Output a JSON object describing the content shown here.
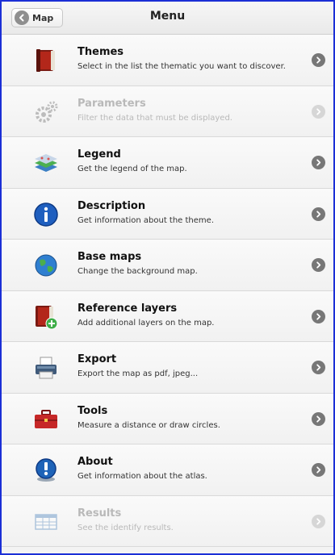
{
  "header": {
    "back_label": "Map",
    "title": "Menu"
  },
  "menu": [
    {
      "label": "Themes",
      "description": "Select in the list the thematic you want to discover.",
      "icon": "book-icon",
      "enabled": true
    },
    {
      "label": "Parameters",
      "description": "Filter the data that must be displayed.",
      "icon": "gears-icon",
      "enabled": false
    },
    {
      "label": "Legend",
      "description": "Get the legend of the map.",
      "icon": "layers-icon",
      "enabled": true
    },
    {
      "label": "Description",
      "description": "Get information about the theme.",
      "icon": "info-icon",
      "enabled": true
    },
    {
      "label": "Base maps",
      "description": "Change the background map.",
      "icon": "globe-icon",
      "enabled": true
    },
    {
      "label": "Reference layers",
      "description": "Add additional layers on the map.",
      "icon": "book-add-icon",
      "enabled": true
    },
    {
      "label": "Export",
      "description": "Export the map as pdf, jpeg...",
      "icon": "printer-icon",
      "enabled": true
    },
    {
      "label": "Tools",
      "description": "Measure a distance or draw circles.",
      "icon": "toolbox-icon",
      "enabled": true
    },
    {
      "label": "About",
      "description": "Get information about the atlas.",
      "icon": "about-icon",
      "enabled": true
    },
    {
      "label": "Results",
      "description": "See the identify results.",
      "icon": "table-icon",
      "enabled": false
    }
  ],
  "colors": {
    "frame_border": "#1b2fd6",
    "arrow": "#777777",
    "arrow_disabled": "#d6d6d6"
  }
}
